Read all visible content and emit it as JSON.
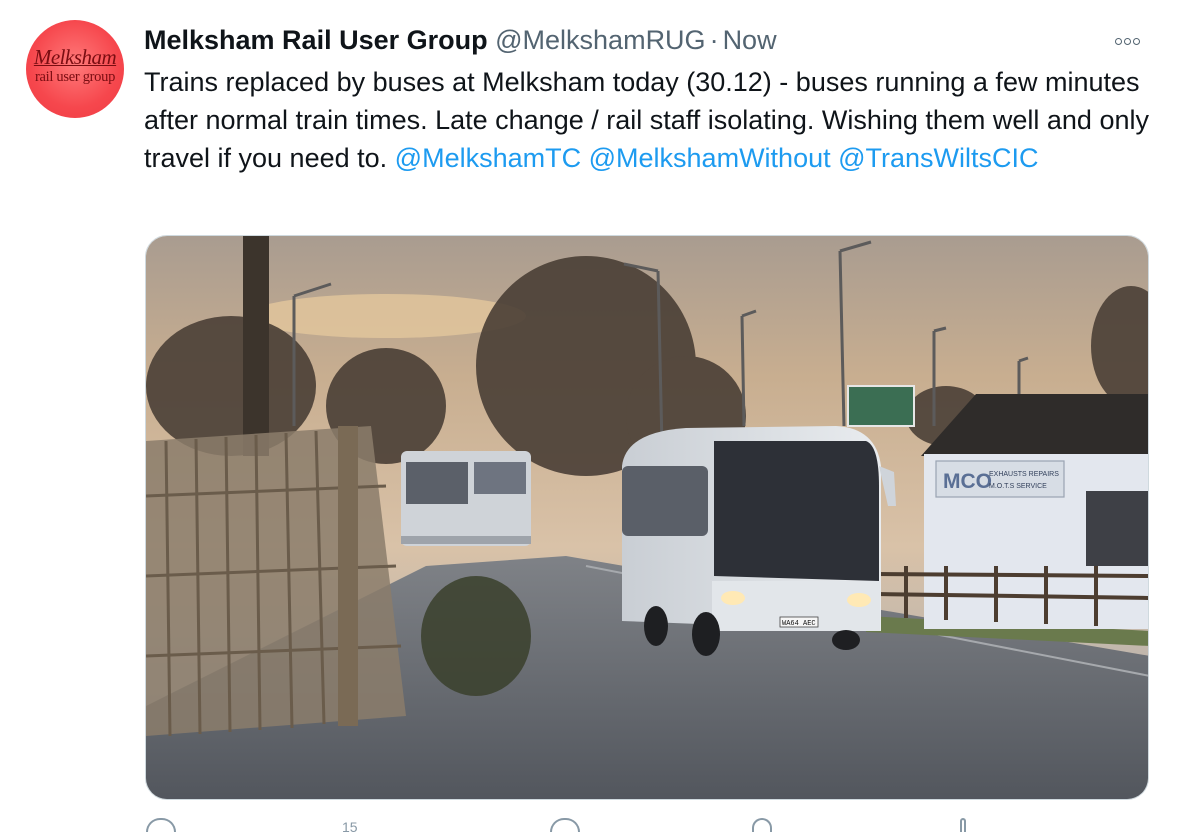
{
  "tweet": {
    "author": {
      "display_name": "Melksham Rail User Group",
      "handle": "@MelkshamRUG",
      "avatar": {
        "line1": "Melksham",
        "line2": "rail user group"
      }
    },
    "separator": "·",
    "timestamp": "Now",
    "more_icon": "ellipsis-icon",
    "text_before": "Trains replaced by buses at Melksham today (30.12) - buses running a few minutes after normal train times. Late change / rail staff isolating. Wishing them well and only travel if you need to.",
    "mentions": [
      "@MelkshamTC",
      "@MelkshamWithout",
      "@TransWiltsCIC"
    ],
    "media": {
      "sign": {
        "line1": "MCO",
        "line2": "EXHAUSTS  REPAIRS",
        "line3": "M.O.T.S  SERVICE"
      },
      "bus_plate": "WA64 AEC"
    },
    "actions": [
      "reply-icon",
      "retweet-icon",
      "like-icon",
      "share-icon",
      "analytics-icon"
    ],
    "reply_count": "15"
  },
  "colors": {
    "accent": "#1d9bf0",
    "muted": "#536471",
    "avatar_bg": "#f6474d"
  }
}
